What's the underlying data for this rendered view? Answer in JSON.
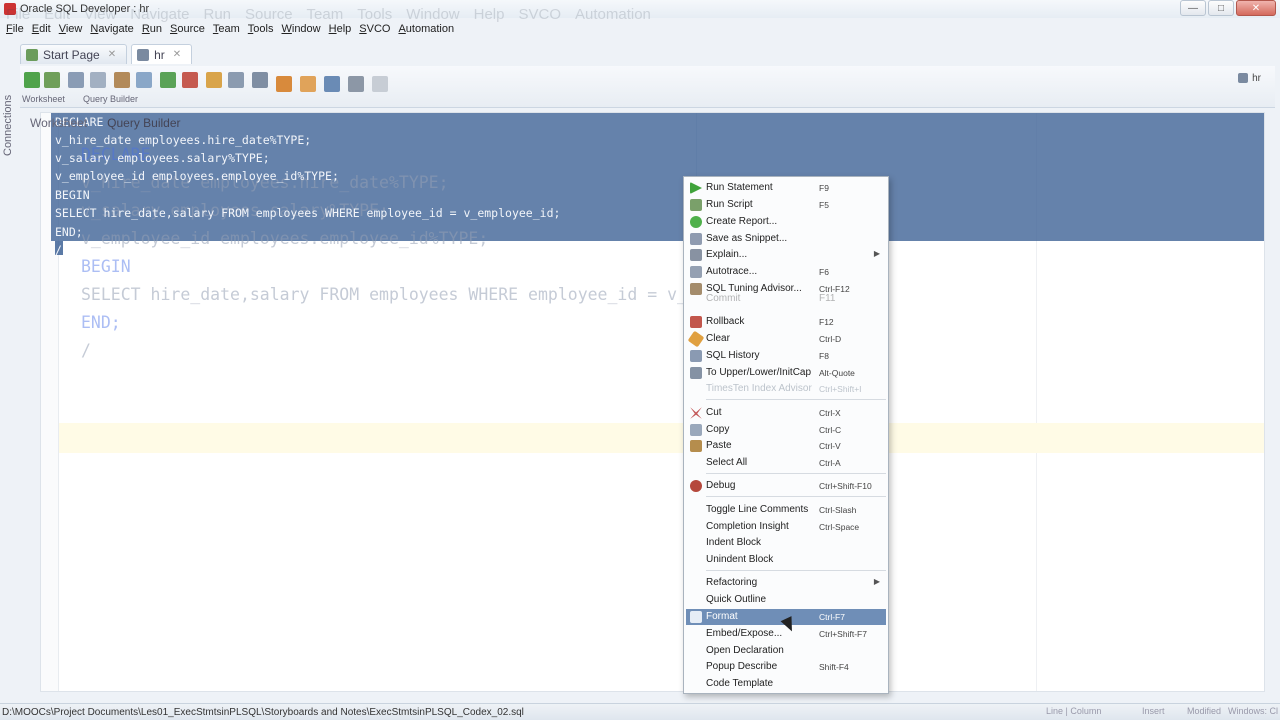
{
  "window": {
    "title": "Oracle SQL Developer : hr"
  },
  "menubar": [
    "File",
    "Edit",
    "View",
    "Navigate",
    "Run",
    "Source",
    "Team",
    "Tools",
    "Window",
    "Help",
    "SVCO",
    "Automation"
  ],
  "tabs": [
    {
      "label": "Start Page"
    },
    {
      "label": "hr"
    }
  ],
  "side_panel": {
    "label": "Connections"
  },
  "toolbar": {
    "worksheet_label": "Worksheet",
    "query_builder_label": "Query Builder",
    "connection": "hr"
  },
  "subtabs": [
    "Worksheet",
    "Query Builder"
  ],
  "editor": {
    "code_lines": [
      "DECLARE",
      "v_hire_date employees.hire_date%TYPE;",
      "v_salary employees.salary%TYPE;",
      "v_employee_id employees.employee_id%TYPE;",
      "BEGIN",
      "SELECT hire_date,salary FROM employees WHERE employee_id = v_employee_id;",
      "END;",
      "/"
    ]
  },
  "context_menu": {
    "items": [
      {
        "label": "Run Statement",
        "shortcut": "F9",
        "icon": "run-icon"
      },
      {
        "label": "Run Script",
        "shortcut": "F5",
        "icon": "script-icon"
      },
      {
        "label": "Create Report...",
        "shortcut": "",
        "icon": "report-icon"
      },
      {
        "label": "Save as Snippet...",
        "shortcut": "",
        "icon": "snippet-icon"
      },
      {
        "label": "Explain...",
        "shortcut": "",
        "icon": "explain-icon",
        "submenu": true
      },
      {
        "label": "Autotrace...",
        "shortcut": "F6",
        "icon": "autotrace-icon"
      },
      {
        "label": "SQL Tuning Advisor...",
        "shortcut": "Ctrl-F12",
        "icon": "tuning-icon"
      },
      {
        "label": "Commit",
        "shortcut": "F11",
        "icon": "commit-icon"
      },
      {
        "label": "Rollback",
        "shortcut": "F12",
        "icon": "rollback-icon"
      },
      {
        "label": "Clear",
        "shortcut": "Ctrl-D",
        "icon": "clear-icon"
      },
      {
        "label": "SQL History",
        "shortcut": "F8",
        "icon": "history-icon"
      },
      {
        "label": "To Upper/Lower/InitCap",
        "shortcut": "Alt-Quote",
        "icon": "case-icon"
      },
      {
        "label": "TimesTen Index Advisor",
        "shortcut": "Ctrl+Shift+I",
        "icon": "index-advisor-icon",
        "disabled": true
      },
      {
        "label": "Cut",
        "shortcut": "Ctrl-X",
        "icon": "cut-icon"
      },
      {
        "label": "Copy",
        "shortcut": "Ctrl-C",
        "icon": "copy-icon"
      },
      {
        "label": "Paste",
        "shortcut": "Ctrl-V",
        "icon": "paste-icon"
      },
      {
        "label": "Select All",
        "shortcut": "Ctrl-A",
        "icon": ""
      },
      {
        "label": "Debug",
        "shortcut": "Ctrl+Shift-F10",
        "icon": "debug-icon"
      },
      {
        "label": "Toggle Line Comments",
        "shortcut": "Ctrl-Slash",
        "icon": ""
      },
      {
        "label": "Completion Insight",
        "shortcut": "Ctrl-Space",
        "icon": ""
      },
      {
        "label": "Indent Block",
        "shortcut": "",
        "icon": ""
      },
      {
        "label": "Unindent Block",
        "shortcut": "",
        "icon": ""
      },
      {
        "label": "Refactoring",
        "shortcut": "",
        "icon": "",
        "submenu": true
      },
      {
        "label": "Quick Outline",
        "shortcut": "",
        "icon": ""
      },
      {
        "label": "Format",
        "shortcut": "Ctrl-F7",
        "icon": "format-icon",
        "highlighted": true
      },
      {
        "label": "Embed/Expose...",
        "shortcut": "Ctrl+Shift-F7",
        "icon": ""
      },
      {
        "label": "Open Declaration",
        "shortcut": "",
        "icon": ""
      },
      {
        "label": "Popup Describe",
        "shortcut": "Shift-F4",
        "icon": ""
      },
      {
        "label": "Code Template",
        "shortcut": "",
        "icon": ""
      }
    ]
  },
  "statusbar": {
    "path": "D:\\MOOCs\\Project Documents\\Les01_ExecStmtsinPLSQL\\Storyboards and Notes\\ExecStmtsinPLSQL_Codex_02.sql",
    "line_column": "Line | Column",
    "insert": "Insert",
    "modified": "Modified",
    "windows": "Windows: Cl"
  },
  "colors": {
    "selection": "#3e6396",
    "menu_highlight": "#6f8eb7",
    "keyword": "#4a6ee6"
  }
}
